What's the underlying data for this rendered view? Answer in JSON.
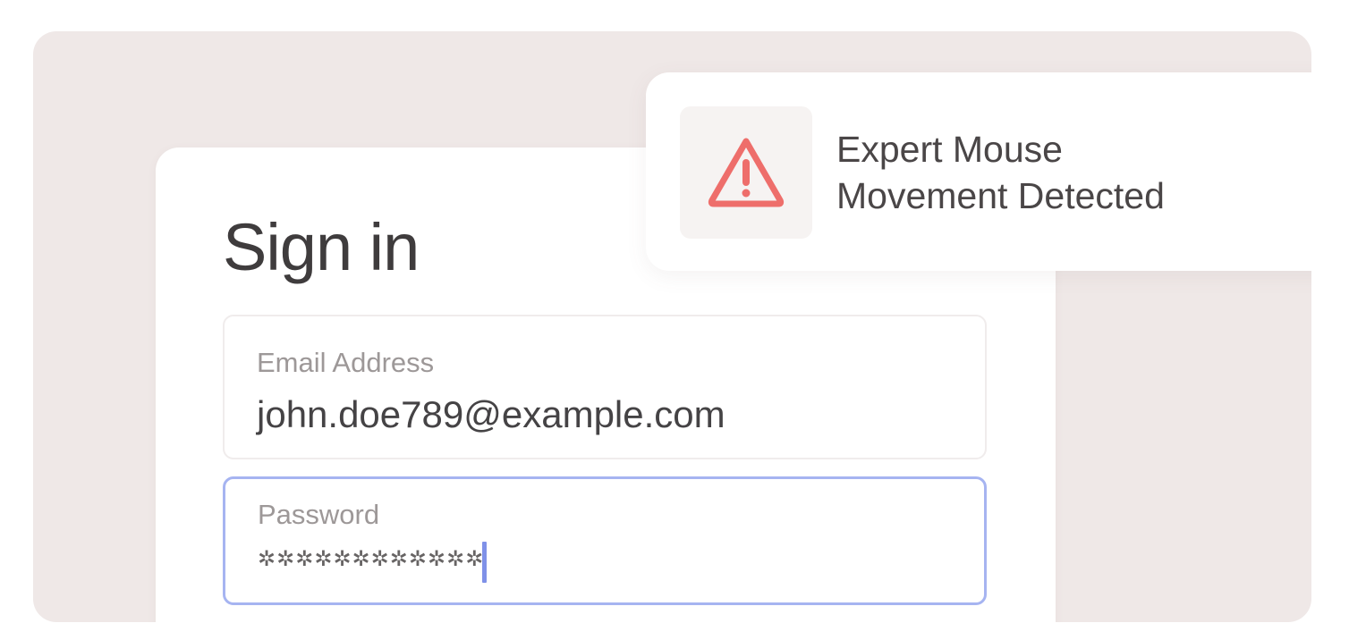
{
  "signin": {
    "title": "Sign in",
    "email_label": "Email Address",
    "email_value": "john.doe789@example.com",
    "password_label": "Password",
    "password_masked": "✲✲✲✲✲✲✲✲✲✲✲✲"
  },
  "toast": {
    "icon": "warning-triangle-icon",
    "line1": "Expert Mouse",
    "line2": "Movement Detected"
  },
  "colors": {
    "background": "#efe8e7",
    "card": "#ffffff",
    "focus_border": "#a6b4f1",
    "warning": "#ee6e6b",
    "caret": "#7f91e8"
  }
}
